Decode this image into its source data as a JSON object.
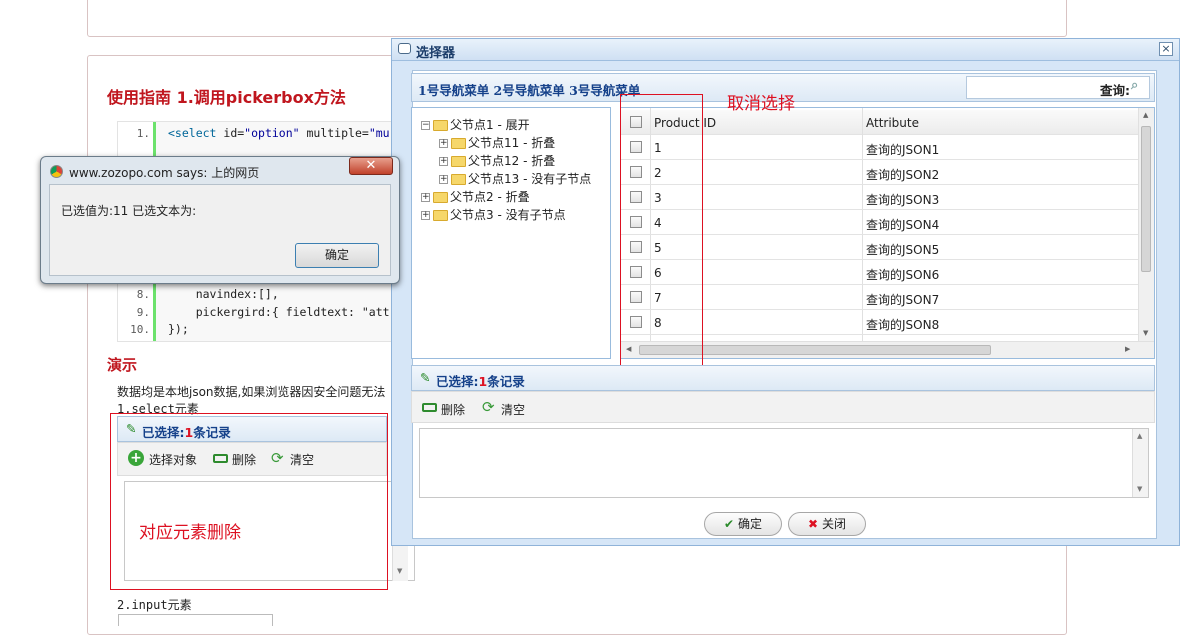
{
  "page": {
    "guide_title": "使用指南 1.调用pickerbox方法",
    "code_lines": [
      {
        "n": "1.",
        "kw": "<select",
        "rest": " id=",
        "s": "\"option\"",
        "rest2": " multiple=",
        "s2": "\"mu"
      },
      {
        "n": "8.",
        "text": "    navindex:[],"
      },
      {
        "n": "9.",
        "text": "    pickergird:{ fieldtext: \"att"
      },
      {
        "n": "10.",
        "text": "});"
      }
    ],
    "demo_title": "演示",
    "demo_desc": "数据均是本地json数据,如果浏览器因安全问题无法",
    "select_label": "1.select元素",
    "selected_prefix": "已选择:",
    "selected_count": "1",
    "selected_suffix": "条记录",
    "tb_select": "选择对象",
    "tb_delete": "删除",
    "tb_clear": "清空",
    "annotation_delete": "对应元素删除",
    "input_label": "2.input元素"
  },
  "dialog": {
    "title": "选择器",
    "nav_menus": "1号导航菜单 2号导航菜单 3号导航菜单",
    "search_label": "查询:",
    "annotation_cancel": "取消选择",
    "tree": [
      {
        "label": "父节点1 - 展开",
        "toggle": "−",
        "level": 0
      },
      {
        "label": "父节点11 - 折叠",
        "toggle": "+",
        "level": 1
      },
      {
        "label": "父节点12 - 折叠",
        "toggle": "+",
        "level": 1
      },
      {
        "label": "父节点13 - 没有子节点",
        "toggle": "+",
        "level": 1
      },
      {
        "label": "父节点2 - 折叠",
        "toggle": "+",
        "level": 0
      },
      {
        "label": "父节点3 - 没有子节点",
        "toggle": "+",
        "level": 0
      }
    ],
    "grid_headers": [
      "Product ID",
      "Attribute"
    ],
    "grid_rows": [
      {
        "id": "1",
        "attr": "查询的JSON1"
      },
      {
        "id": "2",
        "attr": "查询的JSON2"
      },
      {
        "id": "3",
        "attr": "查询的JSON3"
      },
      {
        "id": "4",
        "attr": "查询的JSON4"
      },
      {
        "id": "5",
        "attr": "查询的JSON5"
      },
      {
        "id": "6",
        "attr": "查询的JSON6"
      },
      {
        "id": "7",
        "attr": "查询的JSON7"
      },
      {
        "id": "8",
        "attr": "查询的JSON8"
      }
    ],
    "selected_prefix": "已选择:",
    "selected_count": "1",
    "selected_suffix": "条记录",
    "tb_delete": "删除",
    "tb_clear": "清空",
    "ok": "确定",
    "close": "关闭"
  },
  "alert": {
    "title": "www.zozopo.com says: 上的网页",
    "message": "已选值为:11 已选文本为:",
    "ok": "确定"
  },
  "colors": {
    "annotation": "#d12",
    "header_text": "#15418a",
    "count": "#d12"
  }
}
